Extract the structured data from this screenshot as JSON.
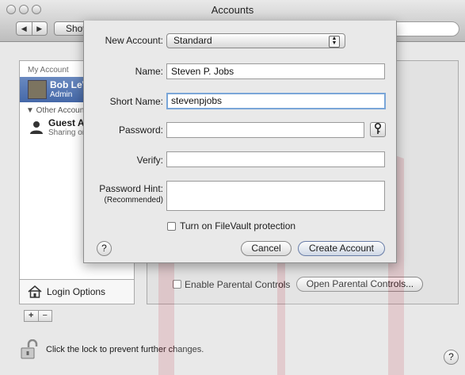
{
  "window": {
    "title": "Accounts"
  },
  "toolbar": {
    "show_all_label": "Show All",
    "back_glyph": "◀",
    "forward_glyph": "▶"
  },
  "sidebar": {
    "my_account_header": "My Account",
    "current_user": {
      "name": "Bob LeV",
      "role": "Admin"
    },
    "other_accounts_header": "▼ Other Accounts",
    "guest": {
      "name": "Guest Account",
      "status": "Sharing only"
    },
    "login_options_label": "Login Options",
    "add_label": "+",
    "remove_label": "−"
  },
  "sheet": {
    "new_account_label": "New Account:",
    "account_type": "Standard",
    "name_label": "Name:",
    "name_value": "Steven P. Jobs",
    "short_name_label": "Short Name:",
    "short_name_value": "stevenpjobs",
    "password_label": "Password:",
    "password_value": "",
    "verify_label": "Verify:",
    "verify_value": "",
    "password_hint_label": "Password Hint:",
    "password_hint_sub": "(Recommended)",
    "filevault_label": "Turn on FileVault protection",
    "help_label": "?",
    "cancel_label": "Cancel",
    "create_label": "Create Account"
  },
  "main": {
    "parental_controls_label": "Enable Parental Controls",
    "open_parental_label": "Open Parental Controls..."
  },
  "footer": {
    "lock_text": "Click the lock to prevent further changes.",
    "help_label": "?"
  },
  "colors": {
    "selection": "#4568a8",
    "focus_ring": "#7aa6d8",
    "watermark": "#c8384a"
  },
  "watermark": {
    "text": "DropBooks"
  }
}
